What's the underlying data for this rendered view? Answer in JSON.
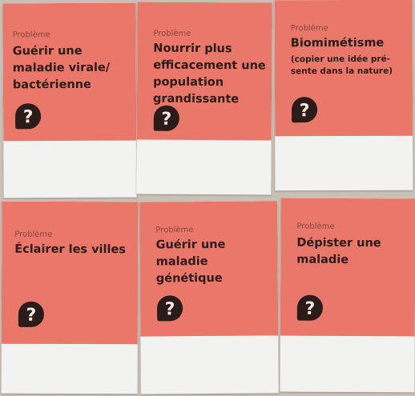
{
  "cards": [
    {
      "kicker": "Problème",
      "title": "Guérir une maladie virale/ bactérienne",
      "subtitle": "",
      "icon": "question-badge-icon"
    },
    {
      "kicker": "Problème",
      "title": "Nourrir plus efficacement une population grandissante",
      "subtitle": "",
      "icon": "question-badge-icon"
    },
    {
      "kicker": "Problème",
      "title": "Biomimétisme",
      "subtitle": "(copier une idée pré-sente dans la nature)",
      "icon": "question-badge-icon"
    },
    {
      "kicker": "Problème",
      "title": "Éclairer les villes",
      "subtitle": "",
      "icon": "question-badge-icon"
    },
    {
      "kicker": "Problème",
      "title": "Guérir une maladie génétique",
      "subtitle": "",
      "icon": "question-badge-icon"
    },
    {
      "kicker": "Problème",
      "title": "Dépister une maladie",
      "subtitle": "",
      "icon": "question-badge-icon"
    }
  ],
  "colors": {
    "card_top": "#e9786b",
    "card_bottom": "#f2f3f0",
    "badge": "#2b1b19",
    "background": "#c9c1b6"
  }
}
